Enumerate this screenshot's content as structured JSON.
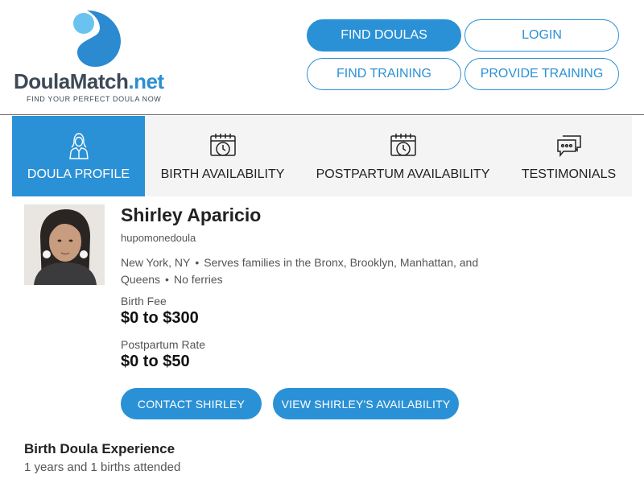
{
  "header": {
    "logo": {
      "brand": "DoulaMatch",
      "tld": ".net",
      "tagline": "FIND YOUR PERFECT DOULA NOW"
    },
    "buttons": [
      {
        "label": "FIND DOULAS",
        "primary": true
      },
      {
        "label": "LOGIN",
        "primary": false
      },
      {
        "label": "FIND TRAINING",
        "primary": false
      },
      {
        "label": "PROVIDE TRAINING",
        "primary": false
      }
    ]
  },
  "tabs": [
    {
      "label": "DOULA PROFILE",
      "icon": "doula-person-icon",
      "active": true
    },
    {
      "label": "BIRTH AVAILABILITY",
      "icon": "calendar-clock-icon",
      "active": false
    },
    {
      "label": "POSTPARTUM AVAILABILITY",
      "icon": "calendar-clock-icon",
      "active": false
    },
    {
      "label": "TESTIMONIALS",
      "icon": "chat-bubbles-icon",
      "active": false
    }
  ],
  "profile": {
    "name": "Shirley Aparicio",
    "username": "hupomonedoula",
    "location": "New York, NY",
    "serves": "Serves families in the Bronx, Brooklyn, Manhattan, and Queens",
    "ferries": "No ferries",
    "birth_fee_label": "Birth Fee",
    "birth_fee_value": "$0 to $300",
    "postpartum_label": "Postpartum Rate",
    "postpartum_value": "$0 to $50",
    "contact_label": "CONTACT SHIRLEY",
    "availability_label": "VIEW SHIRLEY'S AVAILABILITY"
  },
  "experience": {
    "title": "Birth Doula Experience",
    "text": "1 years and 1 births attended"
  },
  "colors": {
    "accent": "#2b91d6",
    "logo_dark": "#3d4957",
    "tab_background": "#f4f4f4"
  }
}
